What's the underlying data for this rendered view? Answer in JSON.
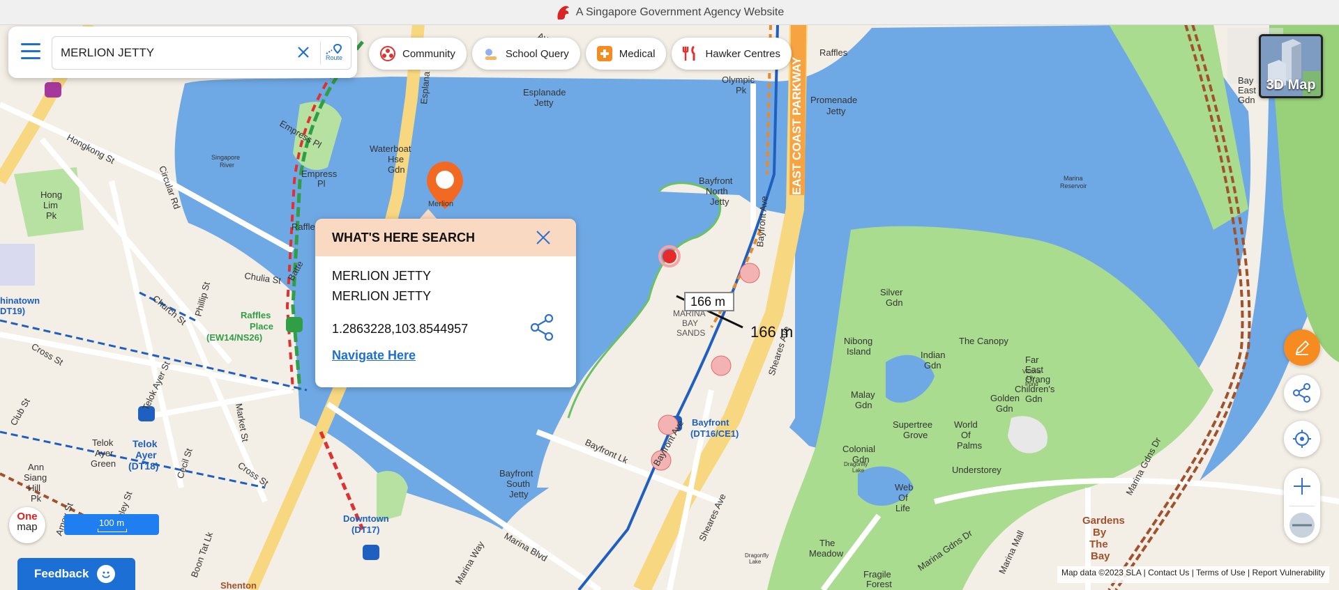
{
  "banner": {
    "text": "A Singapore Government Agency Website"
  },
  "search": {
    "value": "MERLION JETTY",
    "route_label": "Route"
  },
  "chips": [
    {
      "label": "Community",
      "icon": "community-icon"
    },
    {
      "label": "School Query",
      "icon": "school-icon"
    },
    {
      "label": "Medical",
      "icon": "medical-cross-icon"
    },
    {
      "label": "Hawker Centres",
      "icon": "fork-knife-icon"
    }
  ],
  "view3d": {
    "label": "3D Map"
  },
  "popup": {
    "title": "WHAT'S HERE SEARCH",
    "line1": "MERLION JETTY",
    "line2": "MERLION JETTY",
    "coords": "1.2863228,103.8544957",
    "navigate": "Navigate Here"
  },
  "measure": {
    "box_label": "166 m",
    "line_label": "166 m"
  },
  "scale": {
    "label": "100 m"
  },
  "logo": {
    "one": "One",
    "map": "map"
  },
  "feedback": {
    "label": "Feedback"
  },
  "attribution": {
    "data": "Map data ©2023 SLA",
    "links": [
      "Contact Us",
      "Terms of Use",
      "Report Vulnerability"
    ]
  },
  "map_labels": {
    "esplanade_jetty": [
      "Esplanade",
      "Jetty"
    ],
    "olympic_pk": [
      "Olympic",
      "Pk"
    ],
    "promenade_jetty": [
      "Promenade",
      "Jetty"
    ],
    "bay_east_gdn": [
      "Bay",
      "East",
      "Gdn"
    ],
    "raffles_jetty": "Raffles",
    "hongkong_st": "Hongkong St",
    "circular_rd": "Circular Rd",
    "empress_pl": "Empress Pl",
    "empress_pl2": [
      "Empress",
      "Pl"
    ],
    "waterboat": [
      "Waterboat",
      "Hse",
      "Gdn"
    ],
    "singapore_river": [
      "Singapore",
      "River"
    ],
    "merlion": "Merlion",
    "hong_lim_pk": [
      "Hong",
      "Lim",
      "Pk"
    ],
    "bayfront_north_jetty": [
      "Bayfront",
      "North",
      "Jetty"
    ],
    "bayfront_ave": "Bayfront Ave",
    "ecp": "EAST COAST PARKWAY",
    "marina_reservoir": [
      "Marina",
      "Reservoir"
    ],
    "chulia_st": "Chulia St",
    "battery_rd": "Batte",
    "church_st": "Church St",
    "phillip_st": "Phillip St",
    "chinatown": [
      "hinatown",
      "DT19)"
    ],
    "raffles_place": [
      "Raffles",
      "Place",
      "(EW14/NS26)"
    ],
    "marina_bay_sands": [
      "MARINA",
      "BAY",
      "SANDS"
    ],
    "silver_gdn": [
      "Silver",
      "Gdn"
    ],
    "nibong_island": [
      "Nibong",
      "Island"
    ],
    "indian_gdn": [
      "Indian",
      "Gdn"
    ],
    "the_canopy": "The Canopy",
    "far_east_orang": [
      "Far",
      "East",
      "Orang",
      "Children's",
      "Gdn"
    ],
    "victoria_lily_pond": [
      "Victoria",
      "Lily",
      "Pond"
    ],
    "golden_gdn": [
      "Golden",
      "Gdn"
    ],
    "malay_gdn": [
      "Malay",
      "Gdn"
    ],
    "supertree_grove": [
      "Supertree",
      "Grove"
    ],
    "world_of_palms": [
      "World",
      "Of",
      "Palms"
    ],
    "colonial_gdn": [
      "Colonial",
      "Gdn"
    ],
    "understorey": "Understorey",
    "web_of_life": [
      "Web",
      "Of",
      "Life"
    ],
    "dragonfly_lake": [
      "Dragonfly",
      "Lake"
    ],
    "the_meadow": [
      "The",
      "Meadow"
    ],
    "dragonfly_lake2": [
      "Dragonfly",
      "Lake"
    ],
    "fragile_forest": [
      "Fragile",
      "Forest"
    ],
    "gardens_by_the_bay": [
      "Gardens",
      "By",
      "The",
      "Bay"
    ],
    "marina_gdns_dr": "Marina Gdns Dr",
    "marina_gdns_dr2": "Marina Gdns Dr",
    "marina_mall": "Marina Mall",
    "sheares_ave": "Sheares Ave",
    "sheares_ave2": "Sheares Ave",
    "bayfront_station": [
      "Bayfront",
      "(DT16/CE1)"
    ],
    "bayfront_lk": "Bayfront Lk",
    "bayfront_ave2": "Bayfront Ave",
    "bayfront_south_jetty": [
      "Bayfront",
      "South",
      "Jetty"
    ],
    "marina_blvd": "Marina Blvd",
    "marina_way": "Marina Way",
    "downtown": [
      "Downtown",
      "(DT17)"
    ],
    "cross_st": "Cross St",
    "cross_st2": "Cross St",
    "telok_ayer_st": "Telok Ayer St",
    "club_st": "Club St",
    "market_st": "Market St",
    "cecil_st": "Cecil St",
    "telok_ayer_green": [
      "Telok",
      "Ayer",
      "Green"
    ],
    "telok_ayer_station": [
      "Telok",
      "Ayer",
      "(DT18)"
    ],
    "ann_siang": [
      "Ann",
      "Siang",
      "Hill",
      "Pk"
    ],
    "amoy_st": "Amoy St",
    "mcc_st": "nley St",
    "boon_tat_lk": "Boon Tat Lk",
    "shenton": "Shenton",
    "esplanade_dr": "Esplana",
    "ave_top": "Ave",
    "raffles_top": "Raffles"
  }
}
